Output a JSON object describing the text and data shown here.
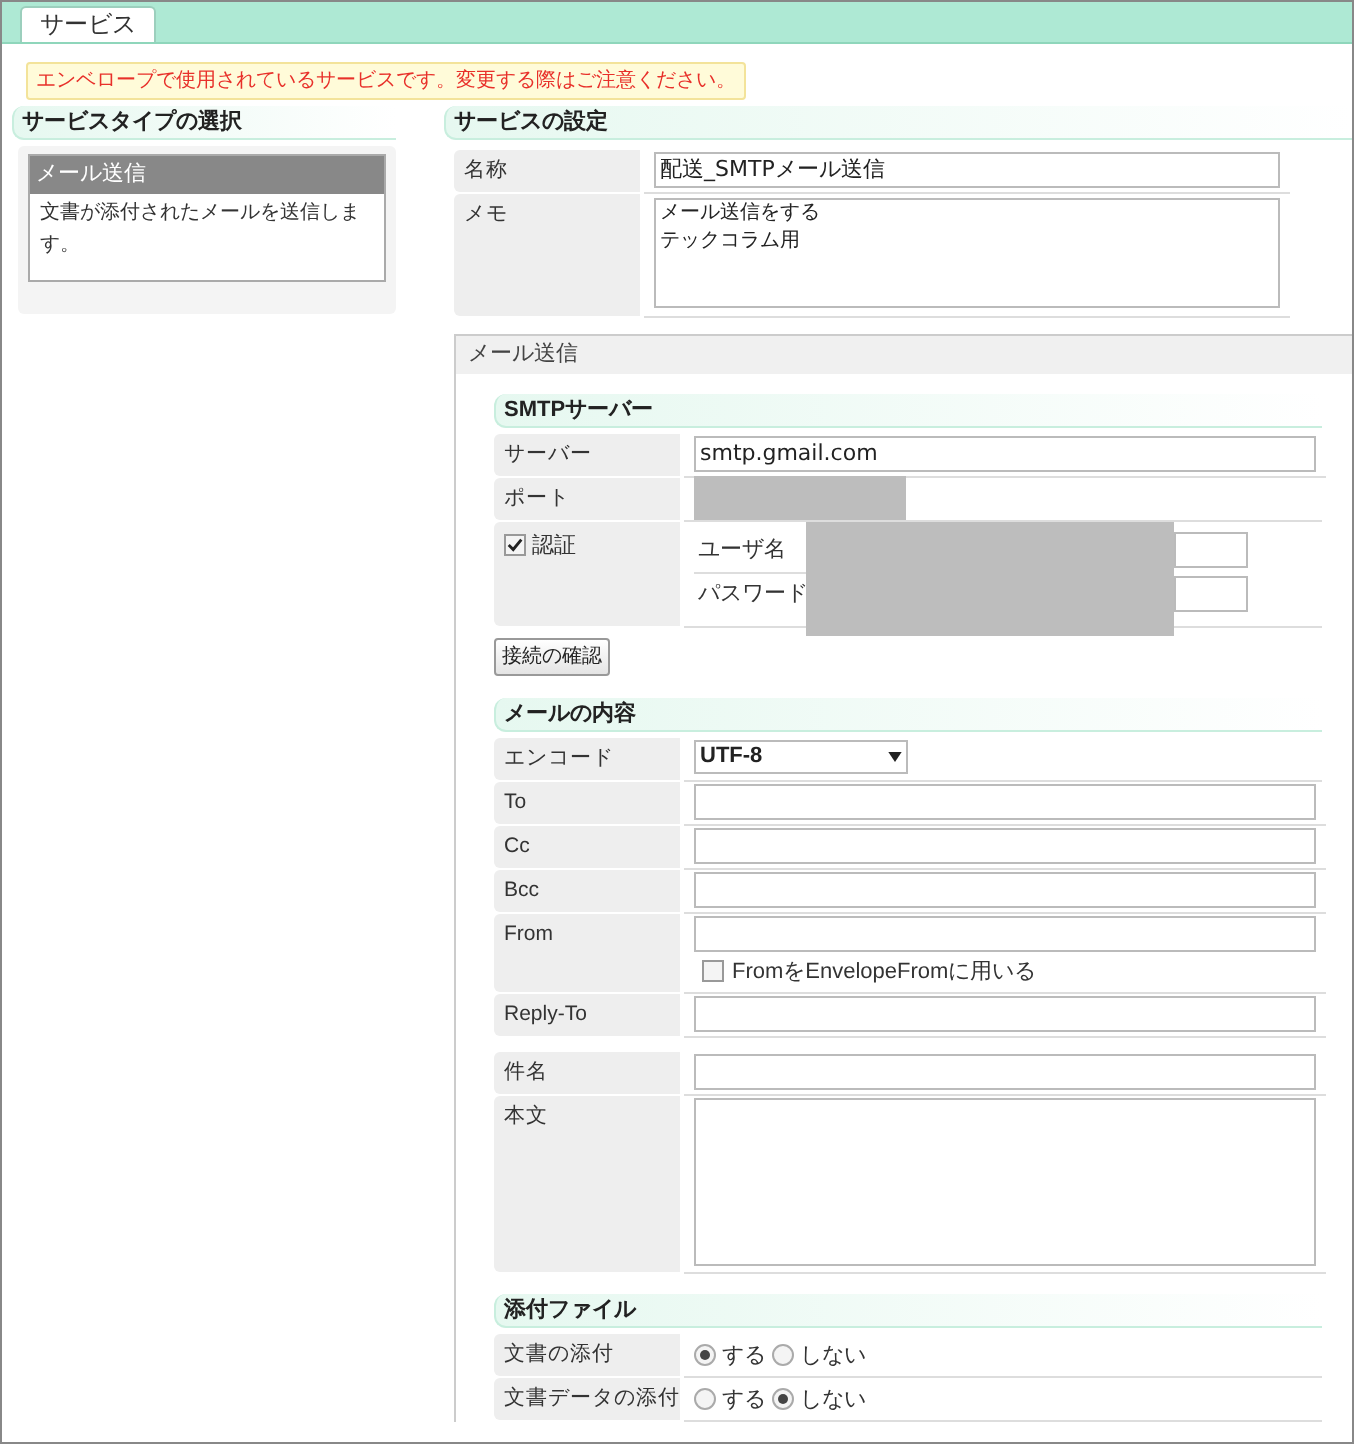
{
  "tab": {
    "label": "サービス",
    "selected": true
  },
  "warning": "エンベロープで使用されているサービスです。変更する際はご注意ください。",
  "service_type": {
    "heading": "サービスタイプの選択",
    "items": [
      {
        "title": "メール送信",
        "description": "文書が添付されたメールを送信します。",
        "selected": true
      }
    ]
  },
  "service_settings": {
    "heading": "サービスの設定",
    "fields": [
      {
        "label": "名称",
        "kind": "input",
        "value": "配送_SMTPメール送信"
      },
      {
        "label": "メモ",
        "kind": "textarea",
        "lines": [
          "メール送信をする",
          "テックコラム用"
        ]
      }
    ]
  },
  "mail_panel": {
    "title": "メール送信",
    "sections": [
      {
        "heading": "SMTPサーバー",
        "rows": [
          {
            "label": "サーバー",
            "kind": "input",
            "value": "smtp.gmail.com"
          },
          {
            "label": "ポート",
            "kind": "input",
            "redacted": true
          },
          {
            "label": "認証",
            "kind": "auth",
            "checked": true,
            "redacted": true,
            "subfields": [
              {
                "label": "ユーザ名"
              },
              {
                "label": "パスワード"
              }
            ]
          }
        ],
        "button": "接続の確認"
      },
      {
        "heading": "メールの内容",
        "rows": [
          {
            "label": "エンコード",
            "kind": "select",
            "value": "UTF-8"
          },
          {
            "label": "To",
            "kind": "input"
          },
          {
            "label": "Cc",
            "kind": "input"
          },
          {
            "label": "Bcc",
            "kind": "input"
          },
          {
            "label": "From",
            "kind": "input",
            "option": {
              "label": "FromをEnvelopeFromに用いる",
              "checked": false
            }
          },
          {
            "label": "Reply-To",
            "kind": "input"
          },
          {
            "kind": "gap"
          },
          {
            "label": "件名",
            "kind": "input"
          },
          {
            "label": "本文",
            "kind": "textarea"
          }
        ]
      },
      {
        "heading": "添付ファイル",
        "rows": [
          {
            "label": "文書の添付",
            "kind": "radio",
            "options": [
              {
                "label": "する",
                "selected": true
              },
              {
                "label": "しない",
                "selected": false
              }
            ]
          },
          {
            "label": "文書データの添付",
            "kind": "radio",
            "options": [
              {
                "label": "する",
                "selected": false
              },
              {
                "label": "しない",
                "selected": true
              }
            ]
          }
        ]
      }
    ]
  }
}
